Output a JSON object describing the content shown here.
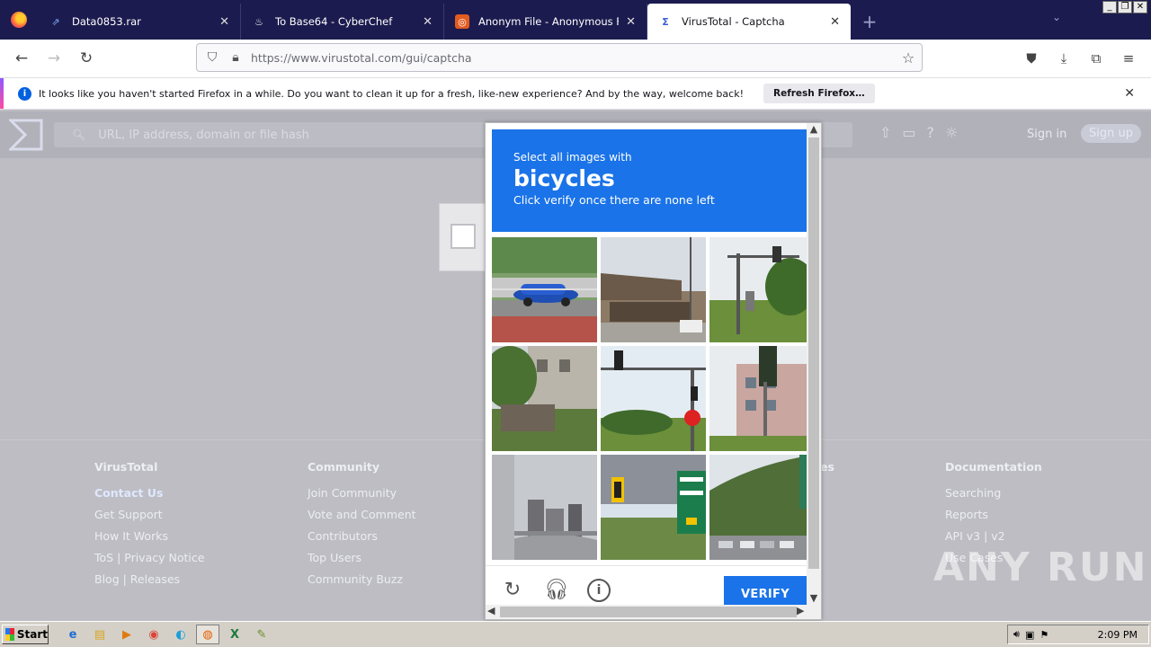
{
  "browser": {
    "tabs": [
      {
        "title": "Data0853.rar",
        "icon": "link-icon"
      },
      {
        "title": "To Base64 - CyberChef",
        "icon": "chef-icon"
      },
      {
        "title": "Anonym File - Anonymous File Uplo",
        "icon": "anonym-icon"
      },
      {
        "title": "VirusTotal - Captcha",
        "icon": "virustotal-icon",
        "active": true
      }
    ],
    "url": "https://www.virustotal.com/gui/captcha"
  },
  "notification": {
    "message": "It looks like you haven't started Firefox in a while. Do you want to clean it up for a fresh, like-new experience? And by the way, welcome back!",
    "button": "Refresh Firefox…"
  },
  "vt": {
    "search_placeholder": "URL, IP address, domain or file hash",
    "sign_in": "Sign in",
    "sign_up": "Sign up"
  },
  "footer": {
    "columns": [
      {
        "heading": "VirusTotal",
        "links": [
          "Contact Us",
          "Get Support",
          "How It Works",
          "ToS | Privacy Notice",
          "Blog | Releases"
        ]
      },
      {
        "heading": "Community",
        "links": [
          "Join Community",
          "Vote and Comment",
          "Contributors",
          "Top Users",
          "Community Buzz"
        ]
      },
      {
        "heading": "es",
        "links": []
      },
      {
        "heading": "Documentation",
        "links": [
          "Searching",
          "Reports",
          "API v3 | v2",
          "Use Cases"
        ]
      }
    ]
  },
  "captcha": {
    "instruction": "Select all images with",
    "target": "bicycles",
    "hint": "Click verify once there are none left",
    "verify": "VERIFY",
    "tiles": [
      "blue car on road",
      "rural building",
      "traffic signal pole",
      "old buildings",
      "traffic lights and stop sign",
      "traffic light near building",
      "highway overpass",
      "road signs",
      "hillside road with cars"
    ]
  },
  "watermark": "ANY RUN",
  "taskbar": {
    "start": "Start",
    "clock": "2:09 PM"
  }
}
